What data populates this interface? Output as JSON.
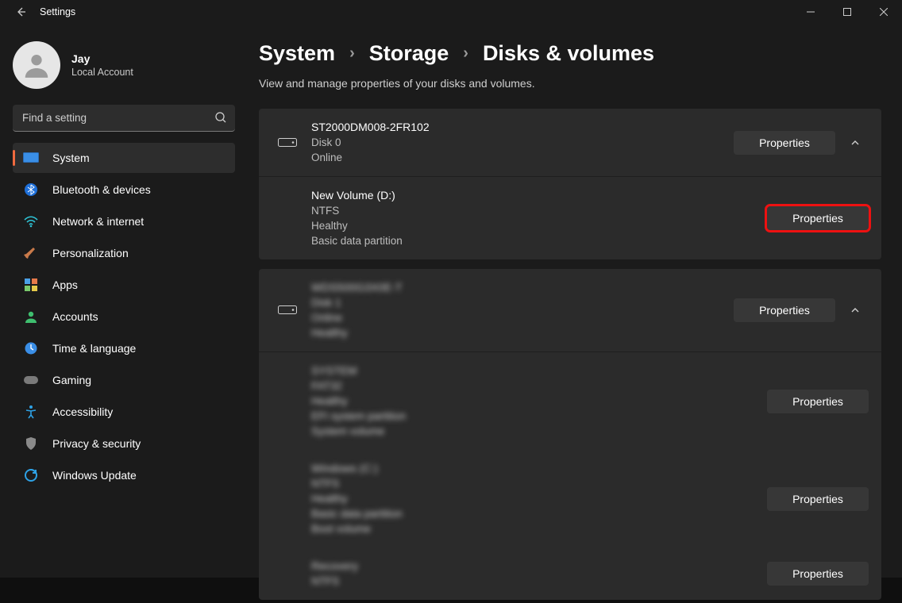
{
  "window": {
    "title": "Settings"
  },
  "user": {
    "name": "Jay",
    "account": "Local Account"
  },
  "search": {
    "placeholder": "Find a setting"
  },
  "nav": {
    "items": [
      {
        "label": "System"
      },
      {
        "label": "Bluetooth & devices"
      },
      {
        "label": "Network & internet"
      },
      {
        "label": "Personalization"
      },
      {
        "label": "Apps"
      },
      {
        "label": "Accounts"
      },
      {
        "label": "Time & language"
      },
      {
        "label": "Gaming"
      },
      {
        "label": "Accessibility"
      },
      {
        "label": "Privacy & security"
      },
      {
        "label": "Windows Update"
      }
    ]
  },
  "breadcrumb": {
    "a": "System",
    "b": "Storage",
    "c": "Disks & volumes"
  },
  "page_subtitle": "View and manage properties of your disks and volumes.",
  "labels": {
    "properties": "Properties"
  },
  "disks": [
    {
      "model": "ST2000DM008-2FR102",
      "id": "Disk 0",
      "status": "Online",
      "volumes": [
        {
          "name": "New Volume (D:)",
          "fs": "NTFS",
          "health": "Healthy",
          "type": "Basic data partition"
        }
      ]
    },
    {
      "model": "",
      "id": "",
      "status": "",
      "blurred": true,
      "volumes": [
        {
          "blurred": true,
          "lines": 5
        },
        {
          "blurred": true,
          "lines": 5
        },
        {
          "blurred": true,
          "lines": 2
        }
      ]
    }
  ]
}
